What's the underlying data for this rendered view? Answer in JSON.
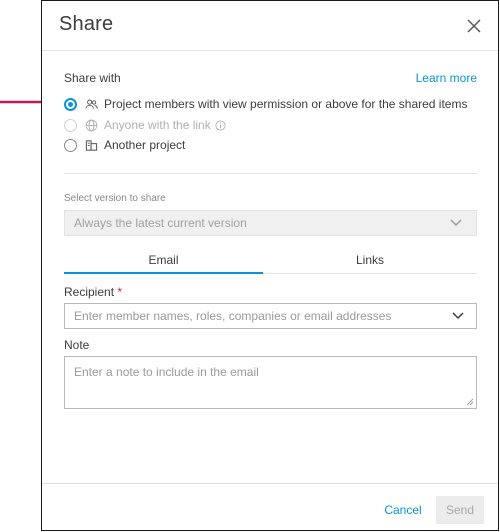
{
  "dialog": {
    "title": "Share",
    "close_icon": "close-icon"
  },
  "share_with": {
    "label": "Share with",
    "learn_more": "Learn more",
    "options": [
      {
        "label": "Project members with view permission or above for the shared items",
        "icon": "people-icon",
        "selected": true,
        "disabled": false
      },
      {
        "label": "Anyone with the link",
        "icon": "globe-icon",
        "selected": false,
        "disabled": true
      },
      {
        "label": "Another project",
        "icon": "project-icon",
        "selected": false,
        "disabled": false
      }
    ]
  },
  "version": {
    "label": "Select version to share",
    "value": "Always the latest current version"
  },
  "tabs": [
    {
      "label": "Email",
      "active": true
    },
    {
      "label": "Links",
      "active": false
    }
  ],
  "recipient": {
    "label": "Recipient",
    "required_mark": "*",
    "placeholder": "Enter member names, roles, companies or email addresses"
  },
  "note": {
    "label": "Note",
    "placeholder": "Enter a note to include in the email"
  },
  "footer": {
    "cancel_label": "Cancel",
    "send_label": "Send"
  },
  "colors": {
    "accent": "#0696d7",
    "annotation_arrow": "#c2185b",
    "required": "#e5222b"
  }
}
